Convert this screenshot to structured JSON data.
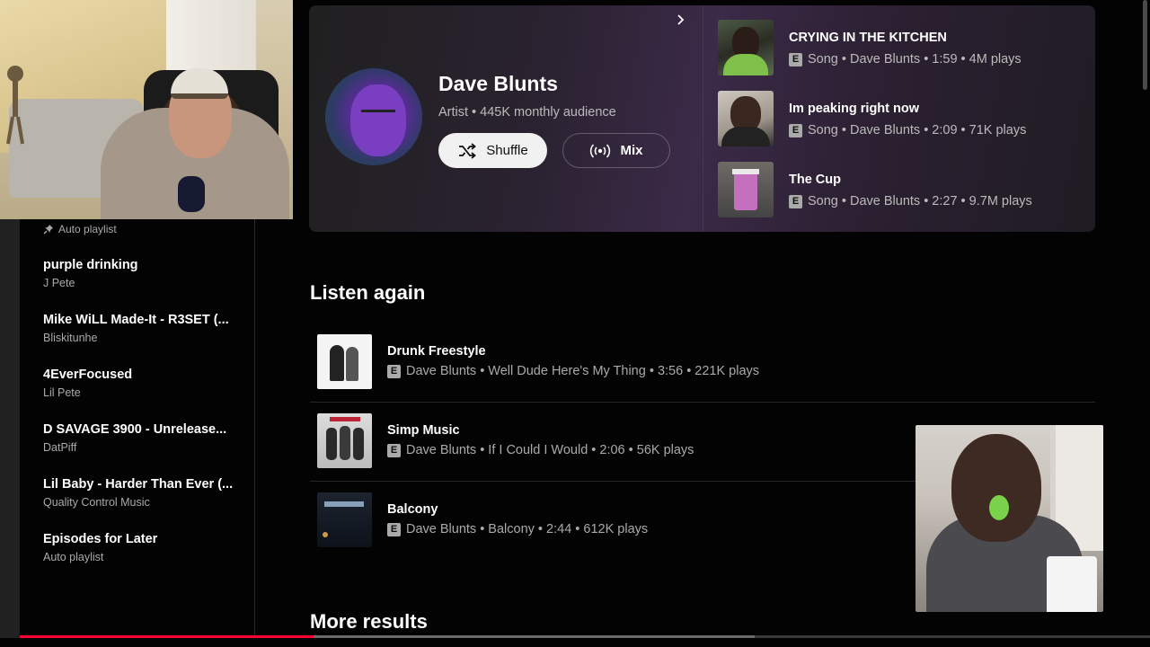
{
  "sidebar": {
    "top_item_sub": "Auto playlist",
    "items": [
      {
        "title": "purple drinking",
        "sub": "J Pete"
      },
      {
        "title": "Mike WiLL Made-It - R3SET (...",
        "sub": "Bliskitunhe"
      },
      {
        "title": "4EverFocused",
        "sub": "Lil Pete"
      },
      {
        "title": "D SAVAGE 3900 - Unrelease...",
        "sub": "DatPiff"
      },
      {
        "title": "Lil Baby - Harder Than Ever (...",
        "sub": "Quality Control Music"
      },
      {
        "title": "Episodes for Later",
        "sub": "Auto playlist"
      }
    ]
  },
  "artist_card": {
    "name": "Dave Blunts",
    "subtitle": "Artist • 445K monthly audience",
    "shuffle_label": "Shuffle",
    "mix_label": "Mix",
    "top_songs": [
      {
        "title": "CRYING IN THE KITCHEN",
        "meta": "Song • Dave Blunts • 1:59 • 4M plays",
        "explicit": "E"
      },
      {
        "title": "Im peaking right now",
        "meta": "Song • Dave Blunts • 2:09 • 71K plays",
        "explicit": "E"
      },
      {
        "title": "The Cup",
        "meta": "Song • Dave Blunts • 2:27 • 9.7M plays",
        "explicit": "E"
      }
    ]
  },
  "listen_again": {
    "title": "Listen again",
    "items": [
      {
        "title": "Drunk Freestyle",
        "meta": "Dave Blunts • Well Dude Here's My Thing • 3:56 • 221K plays",
        "explicit": "E"
      },
      {
        "title": "Simp Music",
        "meta": "Dave Blunts • If I Could I Would • 2:06 • 56K plays",
        "explicit": "E"
      },
      {
        "title": "Balcony",
        "meta": "Dave Blunts • Balcony • 2:44 • 612K plays",
        "explicit": "E"
      }
    ]
  },
  "more_results": {
    "title": "More results"
  },
  "player": {
    "progress": 0.26,
    "buffered": 0.65
  },
  "colors": {
    "background": "#030303",
    "accent": "#ff0033",
    "card_purple": "#3b2a48",
    "muted_text": "#aaaaaa"
  }
}
